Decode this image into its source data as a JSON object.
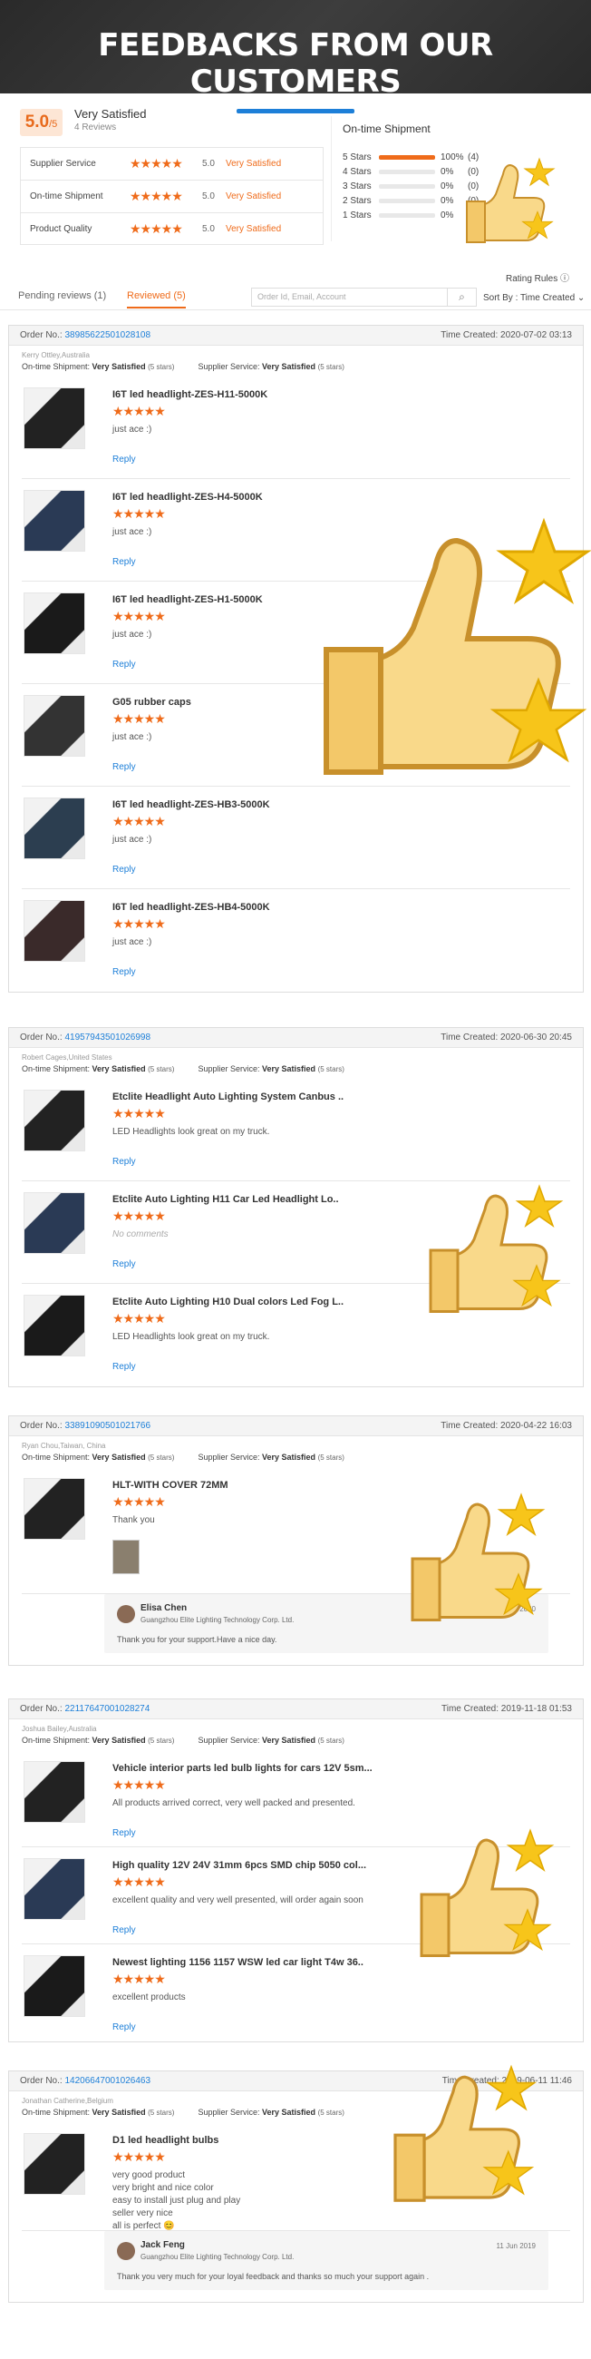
{
  "banner": {
    "title": "FEEDBACKS FROM OUR CUSTOMERS"
  },
  "summary": {
    "score": "5.0",
    "score_max": "/5",
    "title": "Very Satisfied",
    "count": "4 Reviews",
    "metrics": [
      {
        "name": "Supplier Service",
        "stars": "★★★★★",
        "score": "5.0",
        "rating": "Very Satisfied"
      },
      {
        "name": "On-time Shipment",
        "stars": "★★★★★",
        "score": "5.0",
        "rating": "Very Satisfied"
      },
      {
        "name": "Product Quality",
        "stars": "★★★★★",
        "score": "5.0",
        "rating": "Very Satisfied"
      }
    ],
    "shipment_title": "On-time Shipment",
    "distribution": [
      {
        "label": "5 Stars",
        "pct": "100%",
        "count": "(4)",
        "fill": 1.0
      },
      {
        "label": "4 Stars",
        "pct": "0%",
        "count": "(0)",
        "fill": 0
      },
      {
        "label": "3 Stars",
        "pct": "0%",
        "count": "(0)",
        "fill": 0
      },
      {
        "label": "2 Stars",
        "pct": "0%",
        "count": "(0)",
        "fill": 0
      },
      {
        "label": "1 Stars",
        "pct": "0%",
        "count": "(0)",
        "fill": 0
      }
    ]
  },
  "toolbar": {
    "rating_rules": "Rating Rules ⓘ",
    "tab_pending": "Pending reviews (1)",
    "tab_reviewed": "Reviewed (5)",
    "search_placeholder": "Order Id, Email, Account",
    "sort": "Sort By : Time Created ⌄"
  },
  "labels": {
    "order_no": "Order No.:",
    "time_created": "Time Created:",
    "ontime": "On-time Shipment:",
    "supplier": "Supplier Service:",
    "very_satisfied": "Very Satisfied",
    "five_stars": "(5 stars)",
    "reply": "Reply",
    "stars": "★★★★★"
  },
  "orders": [
    {
      "no": "38985622501028108",
      "time": "2020-07-02 03:13",
      "buyer": "Kerry Ottley,Australia",
      "items": [
        {
          "title": "I6T led headlight-ZES-H11-5000K",
          "comment": "just ace :)"
        },
        {
          "title": "I6T led headlight-ZES-H4-5000K",
          "comment": "just ace :)"
        },
        {
          "title": "I6T led headlight-ZES-H1-5000K",
          "comment": "just ace :)"
        },
        {
          "title": "G05 rubber caps",
          "comment": "just ace :)"
        },
        {
          "title": "I6T led headlight-ZES-HB3-5000K",
          "comment": "just ace :)"
        },
        {
          "title": "I6T led headlight-ZES-HB4-5000K",
          "comment": "just ace :)"
        }
      ]
    },
    {
      "no": "41957943501026998",
      "time": "2020-06-30 20:45",
      "buyer": "Robert Cages,United States",
      "items": [
        {
          "title": "Etclite Headlight Auto Lighting System Canbus ..",
          "comment": "LED Headlights look great on my truck."
        },
        {
          "title": "Etclite Auto Lighting H11 Car Led Headlight Lo..",
          "comment": "No comments"
        },
        {
          "title": "Etclite Auto Lighting H10 Dual colors Led Fog L..",
          "comment": "LED Headlights look great on my truck."
        }
      ]
    },
    {
      "no": "33891090501021766",
      "time": "2020-04-22 16:03",
      "buyer": "Ryan Chou,Taiwan, China",
      "items": [
        {
          "title": "HLT-WITH COVER 72MM",
          "comment": "Thank you"
        }
      ],
      "seller": {
        "name": "Elisa Chen",
        "company": "Guangzhou Elite Lighting Technology Corp. Ltd.",
        "date": "22 Apr 2020",
        "message": "Thank you for your support.Have a nice day."
      }
    },
    {
      "no": "22117647001028274",
      "time": "2019-11-18 01:53",
      "buyer": "Joshua Bailey,Australia",
      "items": [
        {
          "title": "Vehicle interior parts led bulb lights for cars 12V 5sm...",
          "comment": "All products arrived correct, very well packed and presented."
        },
        {
          "title": "High quality 12V 24V 31mm 6pcs SMD chip 5050 col...",
          "comment": "excellent quality and very well presented, will order again soon"
        },
        {
          "title": "Newest lighting 1156 1157 WSW led car light T4w 36..",
          "comment": "excellent products"
        }
      ]
    },
    {
      "no": "14206647001026463",
      "time": "2019-06-11 11:46",
      "buyer": "Jonathan Catherine,Belgium",
      "items": [
        {
          "title": "D1 led headlight bulbs",
          "comment_lines": [
            "very good product",
            "very bright and nice color",
            "easy to install just plug and play",
            "seller very nice",
            "all is perfect 😊"
          ]
        }
      ],
      "seller": {
        "name": "Jack Feng",
        "company": "Guangzhou Elite Lighting Technology Corp. Ltd.",
        "date": "11 Jun 2019",
        "message": "Thank you very much for your loyal feedback and thanks so much your support again ."
      }
    }
  ],
  "colors": {
    "accent": "#ef6b1a",
    "link": "#1d7fd8",
    "banner_bar": "#1d7fd8",
    "thumb_bg": "#dcdcdc"
  },
  "icons": {
    "search": "search-icon",
    "info": "info-icon",
    "thumbs_up": "thumbs-up-icon",
    "star": "star-icon"
  }
}
